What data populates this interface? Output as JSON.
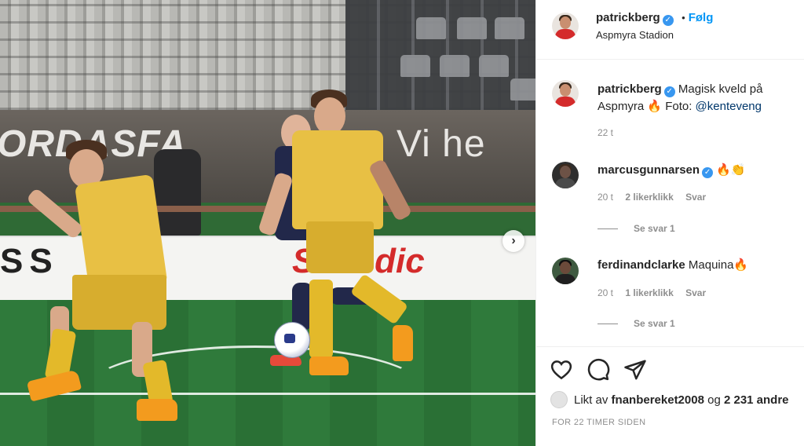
{
  "photo": {
    "banner_text": "ORDASFA",
    "banner_text_right": "Vi he",
    "board_text_left": "SS",
    "board_text_right": "Scandic"
  },
  "header": {
    "username": "patrickberg",
    "dot": "•",
    "follow_label": "Følg",
    "location": "Aspmyra Stadion"
  },
  "caption": {
    "username": "patrickberg",
    "text": "Magisk kveld på Aspmyra 🔥 Foto: ",
    "mention": "@kenteveng",
    "time": "22 t"
  },
  "comments": [
    {
      "username": "marcusgunnarsen",
      "verified": true,
      "text": "🔥👏",
      "time": "20 t",
      "likes": "2 likerklikk",
      "reply_label": "Svar",
      "view_replies": "Se svar 1"
    },
    {
      "username": "ferdinandclarke",
      "verified": false,
      "text": "Maquina🔥",
      "time": "20 t",
      "likes": "1 likerklikk",
      "reply_label": "Svar",
      "view_replies": "Se svar 1"
    }
  ],
  "actions": {
    "like_icon": "heart-icon",
    "comment_icon": "comment-icon",
    "share_icon": "share-icon"
  },
  "likes": {
    "prefix": "Likt av",
    "user": "fnanbereket2008",
    "joiner": "og",
    "others": "2 231 andre"
  },
  "timestamp": "FOR 22 TIMER SIDEN",
  "colors": {
    "accent": "#0095f6",
    "verified": "#3897f0",
    "muted": "#8e8e8e",
    "text": "#262626",
    "jersey_yellow": "#e8c044",
    "away_navy": "#22284a",
    "board_red": "#d42b2b"
  }
}
